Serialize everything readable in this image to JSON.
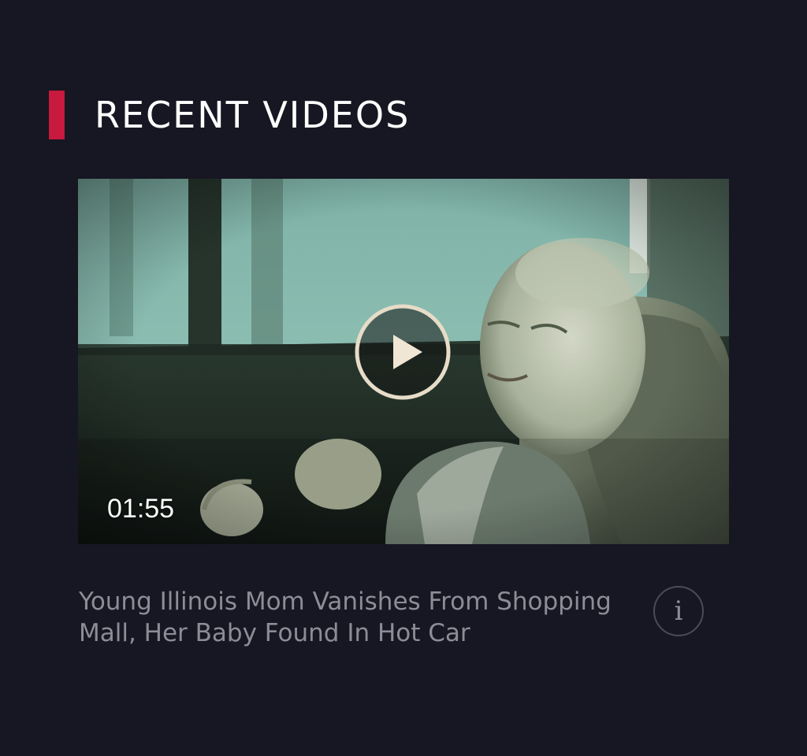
{
  "section": {
    "title": "RECENT VIDEOS",
    "accent_color": "#c8193f"
  },
  "video": {
    "duration": "01:55",
    "title": "Young Illinois Mom Vanishes From Shopping Mall, Her Baby Found In Hot Car",
    "thumbnail_icon": "baby-in-car-seat-image",
    "play_icon": "play-icon",
    "info_icon": "info-icon",
    "info_glyph": "i"
  },
  "colors": {
    "background": "#161722",
    "title_text": "#8c8d96",
    "play_ring": "#e6dcc8"
  }
}
